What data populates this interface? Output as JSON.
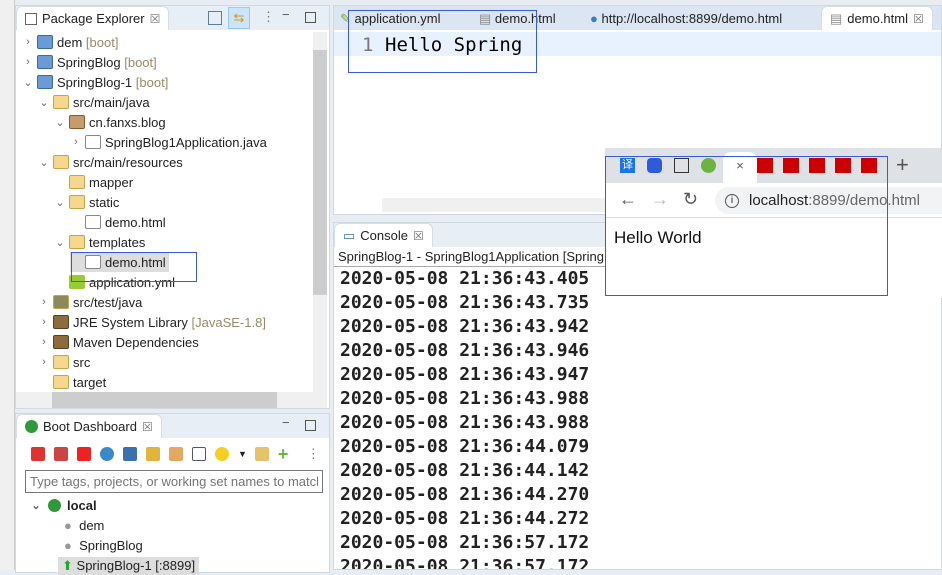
{
  "package_explorer": {
    "title": "Package Explorer",
    "items": [
      {
        "label": "dem",
        "suffix": "[boot]"
      },
      {
        "label": "SpringBlog",
        "suffix": "[boot]"
      },
      {
        "label": "SpringBlog-1",
        "suffix": "[boot]"
      },
      {
        "label": "src/main/java"
      },
      {
        "label": "cn.fanxs.blog"
      },
      {
        "label": "SpringBlog1Application.java"
      },
      {
        "label": "src/main/resources"
      },
      {
        "label": "mapper"
      },
      {
        "label": "static"
      },
      {
        "label": "demo.html"
      },
      {
        "label": "templates"
      },
      {
        "label": "demo.html"
      },
      {
        "label": "application.yml"
      },
      {
        "label": "src/test/java"
      },
      {
        "label": "JRE System Library",
        "suffix": "[JavaSE-1.8]"
      },
      {
        "label": "Maven Dependencies"
      },
      {
        "label": "src"
      },
      {
        "label": "target"
      }
    ]
  },
  "boot_dashboard": {
    "title": "Boot Dashboard",
    "filter_placeholder": "Type tags, projects, or working set names to match",
    "group": "local",
    "apps": [
      "dem",
      "SpringBlog",
      "SpringBlog-1 [:8899]"
    ]
  },
  "editor": {
    "tabs": [
      "application.yml",
      "demo.html",
      "http://localhost:8899/demo.html",
      "demo.html"
    ],
    "line_number": "1",
    "code": "Hello Spring"
  },
  "console": {
    "title": "Console",
    "header": "SpringBlog-1 - SpringBlog1Application [Spring",
    "lines": [
      "2020-05-08 21:36:43.405",
      "2020-05-08 21:36:43.735",
      "2020-05-08 21:36:43.942",
      "2020-05-08 21:36:43.946",
      "2020-05-08 21:36:43.947",
      "2020-05-08 21:36:43.988",
      "2020-05-08 21:36:43.988",
      "2020-05-08 21:36:44.079",
      "2020-05-08 21:36:44.142",
      "2020-05-08 21:36:44.270",
      "2020-05-08 21:36:44.272",
      "2020-05-08 21:36:57.172",
      "2020-05-08 21:36:57.172"
    ]
  },
  "browser": {
    "url_host": "localhost",
    "url_rest": ":8899/demo.html",
    "content": "Hello World",
    "tab_close": "×",
    "new_tab": "+",
    "fav1": "译"
  }
}
